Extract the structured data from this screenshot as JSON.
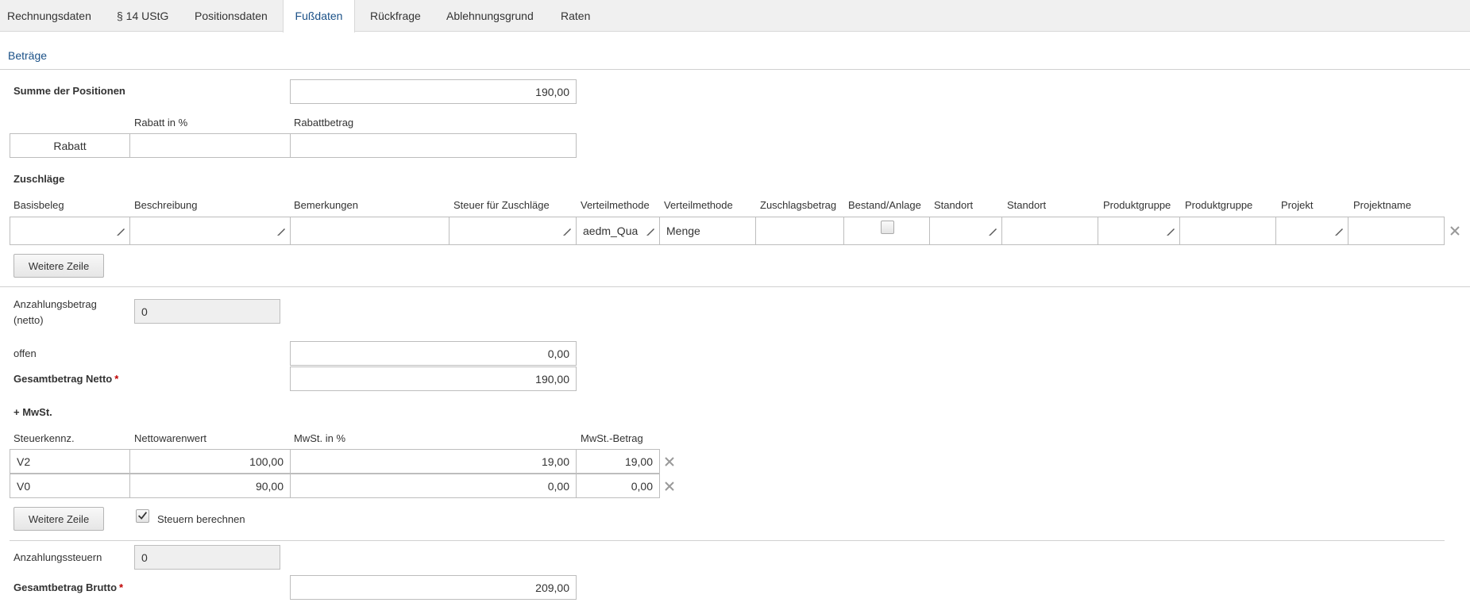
{
  "tabs": [
    {
      "label": "Rechnungsdaten"
    },
    {
      "label": "§ 14 UStG"
    },
    {
      "label": "Positionsdaten"
    },
    {
      "label": "Fußdaten"
    },
    {
      "label": "Rückfrage"
    },
    {
      "label": "Ablehnungsgrund"
    },
    {
      "label": "Raten"
    }
  ],
  "betraege": {
    "title": "Beträge",
    "summe_label": "Summe der Positionen",
    "summe_value": "190,00"
  },
  "rabatt": {
    "col_percent": "Rabatt in %",
    "col_amount": "Rabattbetrag",
    "row_label": "Rabatt",
    "percent_value": "",
    "amount_value": ""
  },
  "zuschlaege": {
    "title": "Zuschläge",
    "headers": [
      "Basisbeleg",
      "Beschreibung",
      "Bemerkungen",
      "Steuer für Zuschläge",
      "Verteilmethode",
      "Verteilmethode",
      "Zuschlagsbetrag",
      "Bestand/Anlage",
      "Standort",
      "Standort",
      "Produktgruppe",
      "Produktgruppe",
      "Projekt",
      "Projektname"
    ],
    "row": {
      "basisbeleg": "",
      "beschreibung": "",
      "bemerkungen": "",
      "steuer": "",
      "verteilmethode_code": "aedm_Qua",
      "verteilmethode_name": "Menge",
      "zuschlagsbetrag": "",
      "bestand_anlage_checked": false,
      "standort_code": "",
      "standort_name": "",
      "produktgruppe_code": "",
      "produktgruppe_name": "",
      "projekt": "",
      "projektname": ""
    },
    "add_row_label": "Weitere Zeile"
  },
  "anzahlung": {
    "label": "Anzahlungsbetrag (netto)",
    "value": "0"
  },
  "offen": {
    "label": "offen",
    "value": "0,00"
  },
  "netto": {
    "label": "Gesamtbetrag Netto",
    "required_mark": "*",
    "value": "190,00"
  },
  "mwst": {
    "title": "+ MwSt.",
    "headers": [
      "Steuerkennz.",
      "Nettowarenwert",
      "MwSt. in %",
      "MwSt.-Betrag"
    ],
    "rows": [
      {
        "code": "V2",
        "netto": "100,00",
        "percent": "19,00",
        "betrag": "19,00"
      },
      {
        "code": "V0",
        "netto": "90,00",
        "percent": "0,00",
        "betrag": "0,00"
      }
    ],
    "add_row_label": "Weitere Zeile",
    "calc_label": "Steuern berechnen",
    "calc_checked": true
  },
  "anzahlungssteuern": {
    "label": "Anzahlungssteuern",
    "value": "0"
  },
  "brutto": {
    "label": "Gesamtbetrag Brutto",
    "required_mark": "*",
    "value": "209,00"
  }
}
